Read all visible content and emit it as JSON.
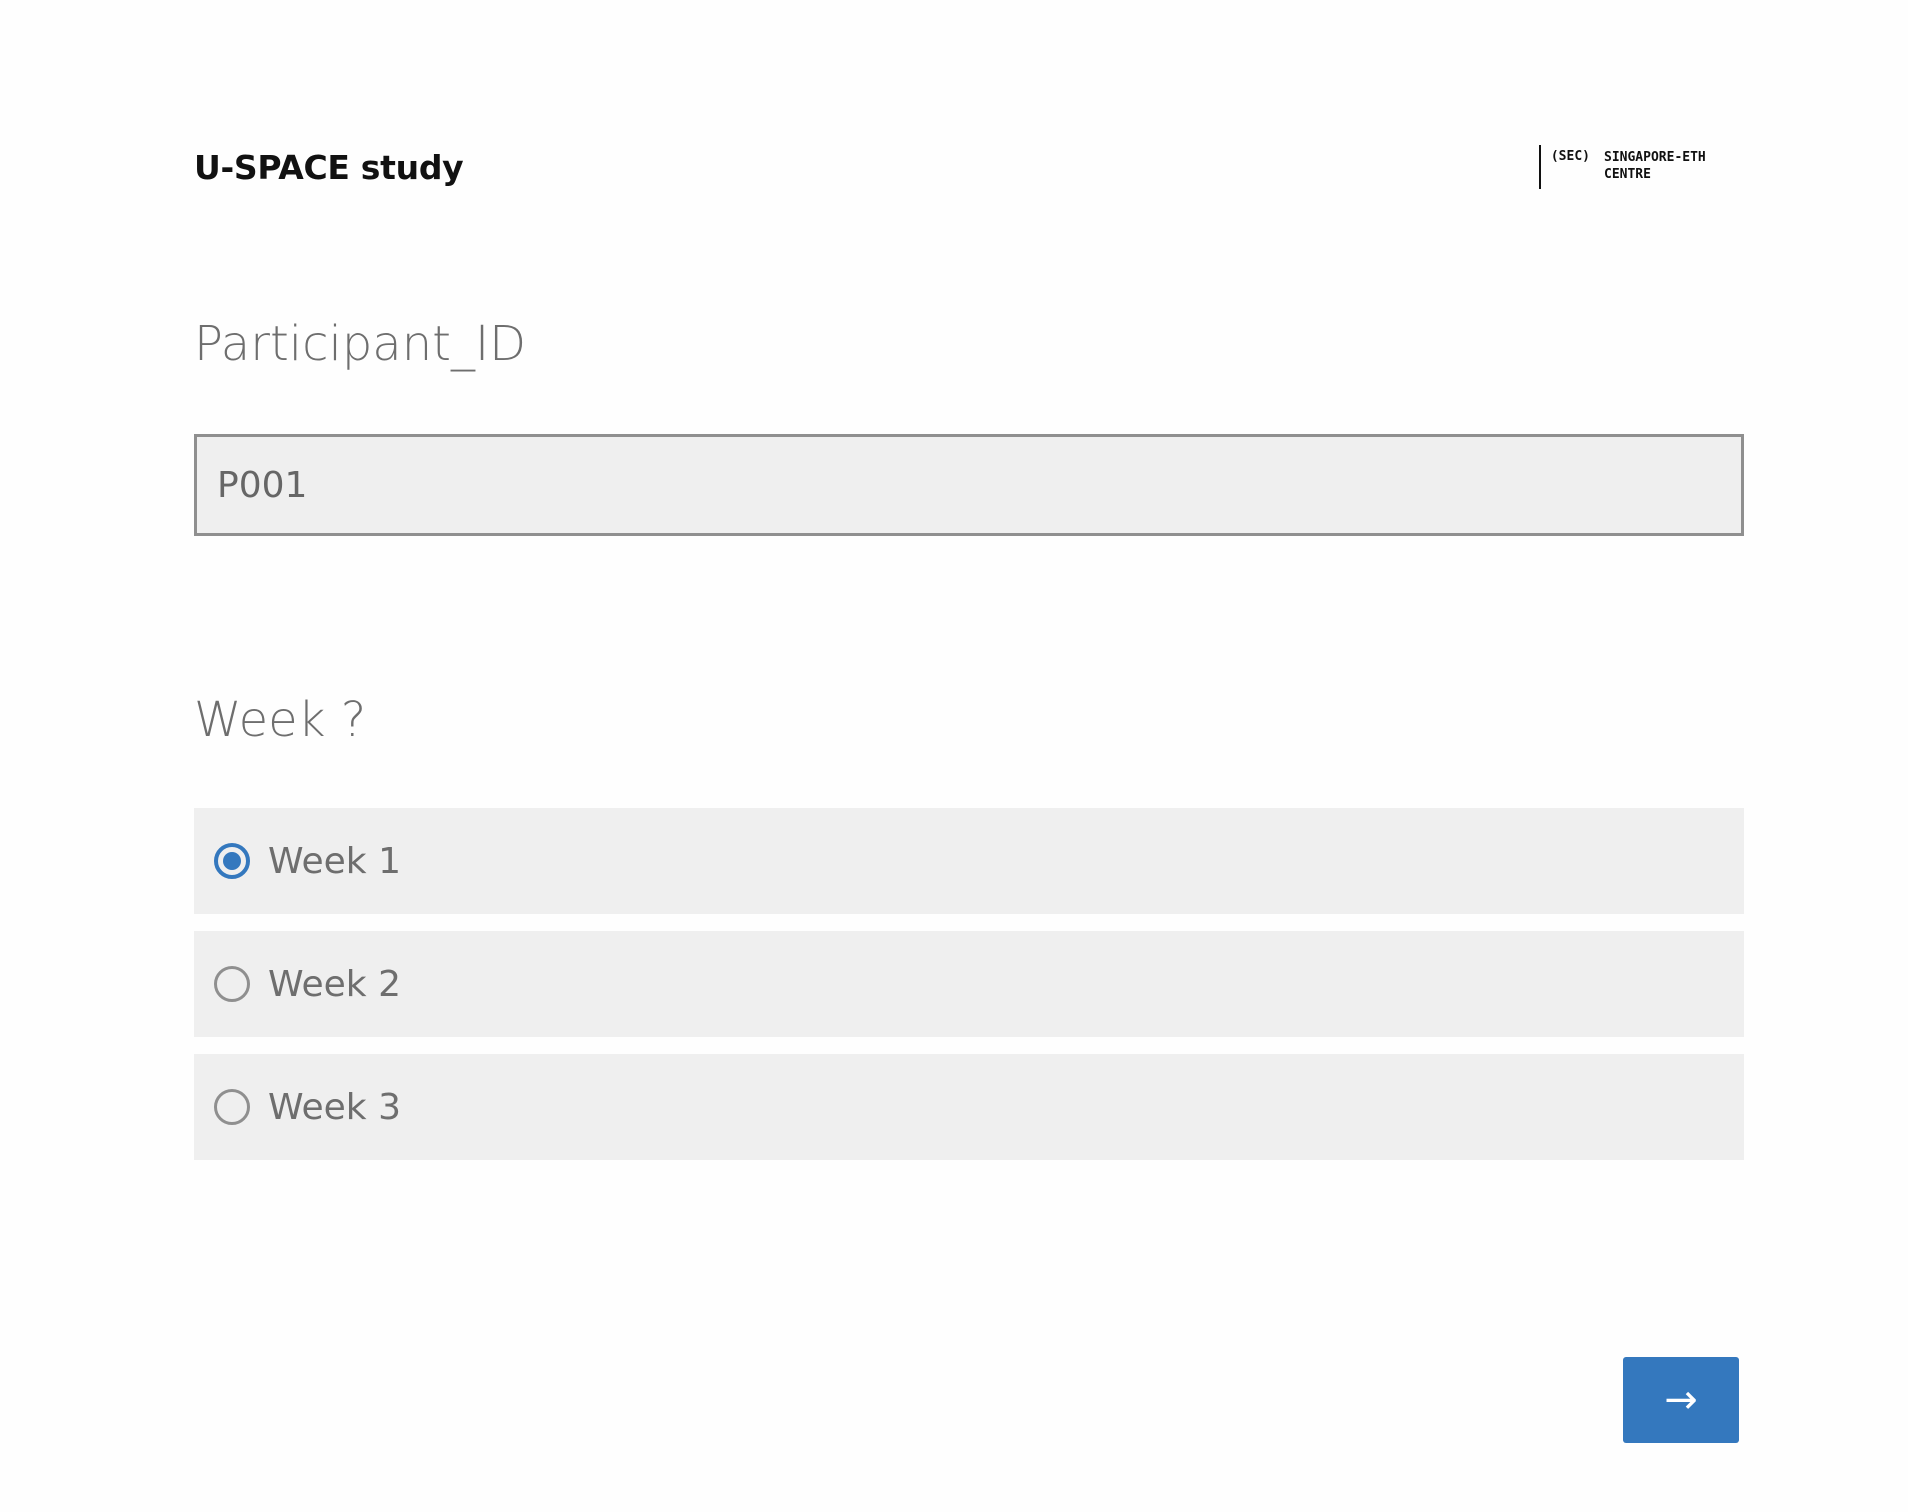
{
  "header": {
    "study_title": "U-SPACE study",
    "logo": {
      "abbreviation": "(SEC)",
      "name": "SINGAPORE-ETH CENTRE"
    }
  },
  "questions": [
    {
      "label": "Participant_ID",
      "input_value": "P001"
    },
    {
      "label": "Week ?",
      "choices": [
        {
          "label": "Week 1",
          "selected": true
        },
        {
          "label": "Week 2",
          "selected": false
        },
        {
          "label": "Week 3",
          "selected": false
        }
      ]
    }
  ],
  "navigation": {
    "next_label": "→"
  },
  "colors": {
    "accent": "#3478be",
    "field_background": "#efefef",
    "question_text": "#6e6e6e"
  },
  "icons": {
    "next": "arrow-right-icon",
    "radio_selected": "radio-checked-icon",
    "radio_unselected": "radio-unchecked-icon"
  }
}
